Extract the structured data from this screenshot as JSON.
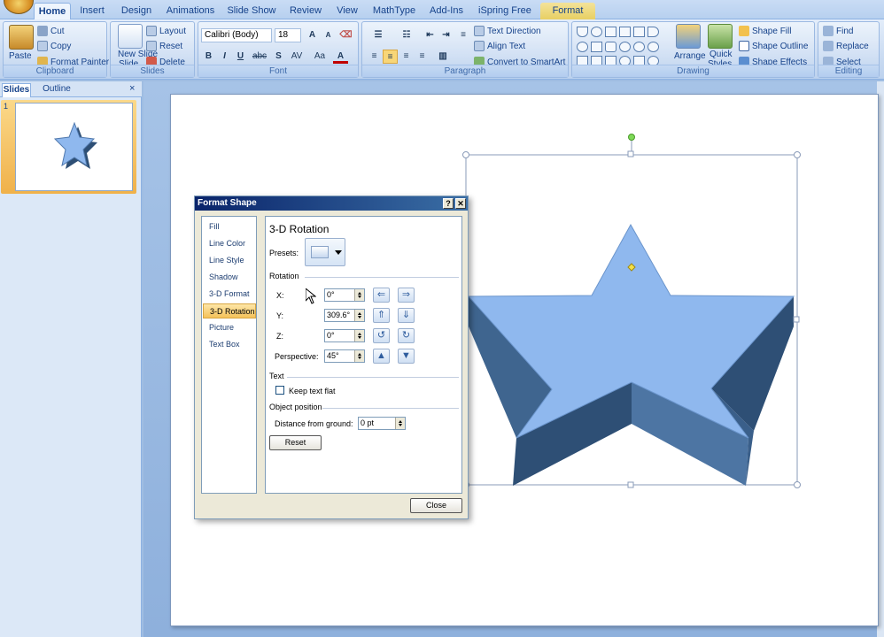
{
  "ribbon_tabs": [
    "Home",
    "Insert",
    "Design",
    "Animations",
    "Slide Show",
    "Review",
    "View",
    "MathType",
    "Add-Ins",
    "iSpring Free",
    "Format"
  ],
  "clipboard": {
    "paste": "Paste",
    "cut": "Cut",
    "copy": "Copy",
    "format_painter": "Format Painter",
    "label": "Clipboard"
  },
  "slides_group": {
    "new_slide": "New Slide",
    "new_slide_2": "Slide",
    "layout": "Layout",
    "reset": "Reset",
    "delete": "Delete",
    "label": "Slides"
  },
  "font": {
    "name": "Calibri (Body)",
    "size": "18",
    "label": "Font",
    "bold": "B",
    "italic": "I",
    "underline": "U",
    "strike": "abc",
    "shadow": "S",
    "spacing": "AV",
    "case": "Aa",
    "color": "A"
  },
  "paragraph": {
    "text_direction": "Text Direction",
    "align_text": "Align Text",
    "convert_smartart": "Convert to SmartArt",
    "label": "Paragraph"
  },
  "drawing": {
    "arrange": "Arrange",
    "quick": "Quick",
    "styles": "Styles",
    "shape_fill": "Shape Fill",
    "shape_outline": "Shape Outline",
    "shape_effects": "Shape Effects",
    "label": "Drawing"
  },
  "editing": {
    "find": "Find",
    "replace": "Replace",
    "select": "Select",
    "label": "Editing"
  },
  "pane_tabs": {
    "slides": "Slides",
    "outline": "Outline"
  },
  "thumbnail_number": "1",
  "dialog": {
    "title": "Format Shape",
    "help": "?",
    "close_x": "✕",
    "nav": [
      "Fill",
      "Line Color",
      "Line Style",
      "Shadow",
      "3-D Format",
      "3-D Rotation",
      "Picture",
      "Text Box"
    ],
    "heading": "3-D Rotation",
    "presets_label": "Presets:",
    "rotation_label": "Rotation",
    "x_label": "X:",
    "x_value": "0°",
    "y_label": "Y:",
    "y_value": "309.6°",
    "z_label": "Z:",
    "z_value": "0°",
    "perspective_label": "Perspective:",
    "perspective_value": "45°",
    "text_section": "Text",
    "keep_text_flat": "Keep text flat",
    "object_position": "Object position",
    "distance_label": "Distance from ground:",
    "distance_value": "0 pt",
    "reset_button": "Reset",
    "close_button": "Close"
  },
  "colors": {
    "star_face": "#8fb8ee",
    "star_side": "#3a5f8a",
    "ribbon_bg": "#c7d9f1",
    "selected_tab": "#f5c25a"
  },
  "icons": [
    "office-button-icon",
    "paste-icon",
    "cut-icon",
    "copy-icon",
    "format-painter-icon",
    "new-slide-icon",
    "find-icon",
    "replace-icon",
    "arrange-icon",
    "quick-styles-icon"
  ]
}
